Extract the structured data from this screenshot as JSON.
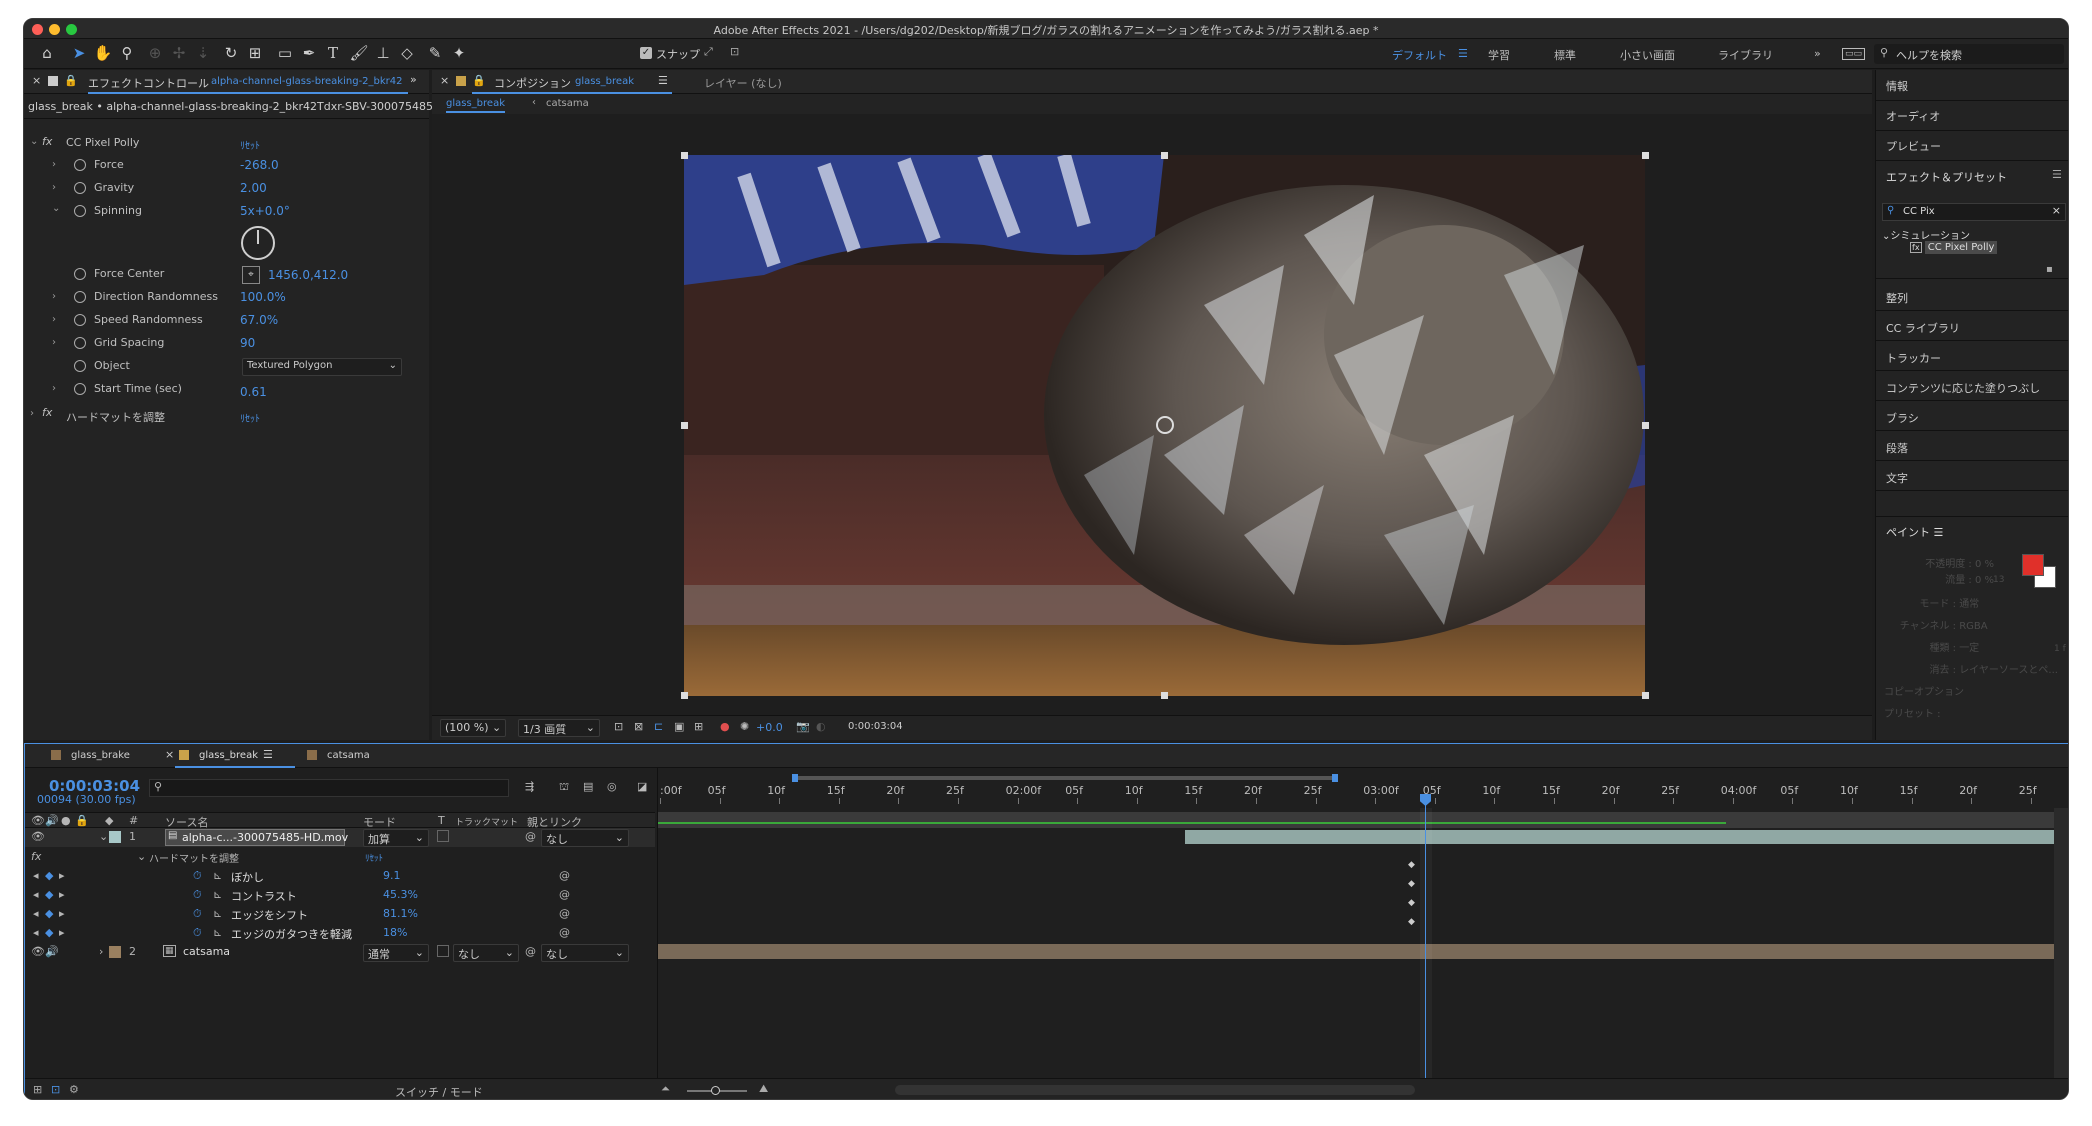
{
  "title": "Adobe After Effects 2021 - /Users/dg202/Desktop/新規ブログ/ガラスの割れるアニメーションを作ってみよう/ガラス割れる.aep *",
  "toolbar": {
    "snap_label": "スナップ",
    "workspaces": [
      "デフォルト",
      "学習",
      "標準",
      "小さい画面",
      "ライブラリ"
    ],
    "search_placeholder": "ヘルプを検索"
  },
  "effects_panel": {
    "tab_label": "エフェクトコントロール",
    "tab_layer": "alpha-channel-glass-breaking-2_bkr42",
    "breadcrumb": "glass_break • alpha-channel-glass-breaking-2_bkr42Tdxr-SBV-300075485",
    "effect_name": "CC Pixel Polly",
    "reset_label": "ﾘｾｯﾄ",
    "props": [
      {
        "name": "Force",
        "value": "-268.0"
      },
      {
        "name": "Gravity",
        "value": "2.00"
      },
      {
        "name": "Spinning",
        "value": "5x+0.0°"
      },
      {
        "name": "Force Center",
        "value": "1456.0,412.0"
      },
      {
        "name": "Direction Randomness",
        "value": "100.0%"
      },
      {
        "name": "Speed Randomness",
        "value": "67.0%"
      },
      {
        "name": "Grid Spacing",
        "value": "90"
      },
      {
        "name": "Object",
        "value": "Textured Polygon"
      },
      {
        "name": "Start Time (sec)",
        "value": "0.61"
      }
    ],
    "effect2_name": "ハードマットを調整",
    "effect2_reset": "ﾘｾｯﾄ"
  },
  "comp_panel": {
    "tab_label": "コンポジション",
    "tab_comp": "glass_break",
    "layer_tab": "レイヤー (なし)",
    "crumbs": [
      "glass_break",
      "catsama"
    ],
    "zoom": "(100 %)",
    "quality": "1/3 画質",
    "exposure": "+0.0",
    "timecode": "0:00:03:04"
  },
  "right_panel": {
    "items_top": [
      "情報",
      "オーディオ",
      "プレビュー"
    ],
    "effects_presets": "エフェクト＆プリセット",
    "search_value": "CC Pix",
    "category": "シミュレーション",
    "result": "CC Pixel Polly",
    "items_mid": [
      "整列",
      "CC ライブラリ",
      "トラッカー",
      "コンテンツに応じた塗りつぶし",
      "ブラシ",
      "段落",
      "文字"
    ],
    "paint_label": "ペイント",
    "paint_rows": [
      {
        "label": "不透明度 :",
        "value": "0 %"
      },
      {
        "label": "流量 :",
        "value": "0 %"
      },
      {
        "label": "モード :",
        "value": "通常"
      },
      {
        "label": "チャンネル :",
        "value": "RGBA"
      },
      {
        "label": "種類 :",
        "value": "一定"
      },
      {
        "label": "消去 :",
        "value": "レイヤーソースとペ..."
      }
    ],
    "paint_side_nums": [
      "13",
      "1 f"
    ],
    "copy_option": "コピーオプション",
    "preset": "プリセット :",
    "fg_color": "#e0302a",
    "bg_color": "#ffffff"
  },
  "timeline": {
    "tabs": [
      "glass_brake",
      "glass_break",
      "catsama"
    ],
    "timecode": "0:00:03:04",
    "frames": "00094 (30.00 fps)",
    "col_headers": {
      "source": "ソース名",
      "mode": "モード",
      "t": "T",
      "trkmat": "トラックマット",
      "parent": "親とリンク"
    },
    "ruler": [
      ":00f",
      "05f",
      "10f",
      "15f",
      "20f",
      "25f",
      "02:00f",
      "05f",
      "10f",
      "15f",
      "20f",
      "25f",
      "03:00f",
      "05f",
      "10f",
      "15f",
      "20f",
      "25f",
      "04:00f",
      "05f",
      "10f",
      "15f",
      "20f",
      "25f"
    ],
    "layer1": {
      "num": "1",
      "name": "alpha-c...-300075485-HD.mov",
      "mode": "加算",
      "parent": "なし"
    },
    "fx_group": "ハードマットを調整",
    "fx_reset": "ﾘｾｯﾄ",
    "fx_props": [
      {
        "name": "ぼかし",
        "value": "9.1"
      },
      {
        "name": "コントラスト",
        "value": "45.3%"
      },
      {
        "name": "エッジをシフト",
        "value": "81.1%"
      },
      {
        "name": "エッジのガタつきを軽減",
        "value": "18%"
      }
    ],
    "layer2": {
      "num": "2",
      "name": "catsama",
      "mode": "通常",
      "trkmat": "なし",
      "parent": "なし"
    },
    "footer": "スイッチ / モード"
  }
}
